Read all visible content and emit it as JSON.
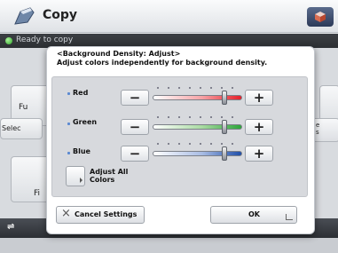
{
  "app": {
    "title": "Copy",
    "status": "Ready to copy",
    "bg_left_1_label": "Fu",
    "bg_left_2_label": "Selec",
    "bg_left_3_label": "Fi",
    "bg_right_2_label": "e\ns"
  },
  "dialog": {
    "title": "<Background Density: Adjust>",
    "description": "Adjust colors independently for background density.",
    "rows": [
      {
        "label": "Red",
        "minus": "−",
        "plus": "+",
        "level": 0.8
      },
      {
        "label": "Green",
        "minus": "−",
        "plus": "+",
        "level": 0.8
      },
      {
        "label": "Blue",
        "minus": "−",
        "plus": "+",
        "level": 0.8
      }
    ],
    "adjust_all_label": "Adjust All\nColors",
    "cancel_label": "Cancel Settings",
    "cancel_icon": "×",
    "ok_label": "OK"
  },
  "colors": {
    "red_track": "#e5202a",
    "green_track": "#2da53a",
    "blue_track": "#1f4ea8",
    "status_dot": "#2fa52a"
  }
}
